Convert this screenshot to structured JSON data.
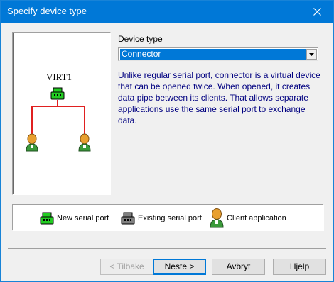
{
  "window": {
    "title": "Specify device type"
  },
  "diagram": {
    "device_name": "VIRT1",
    "link_color": "#e02020",
    "device_color": "#22cc22"
  },
  "device_type": {
    "label": "Device type",
    "selected": "Connector",
    "description": "Unlike regular serial port, connector is a virtual device that can be opened twice. When opened, it creates data pipe between its clients. That allows separate applications use the same serial port to exchange data."
  },
  "legend": {
    "new_port": "New serial port",
    "existing_port": "Existing serial port",
    "client_app": "Client application"
  },
  "buttons": {
    "back": "< Tilbake",
    "next": "Neste >",
    "cancel": "Avbryt",
    "help": "Hjelp"
  }
}
